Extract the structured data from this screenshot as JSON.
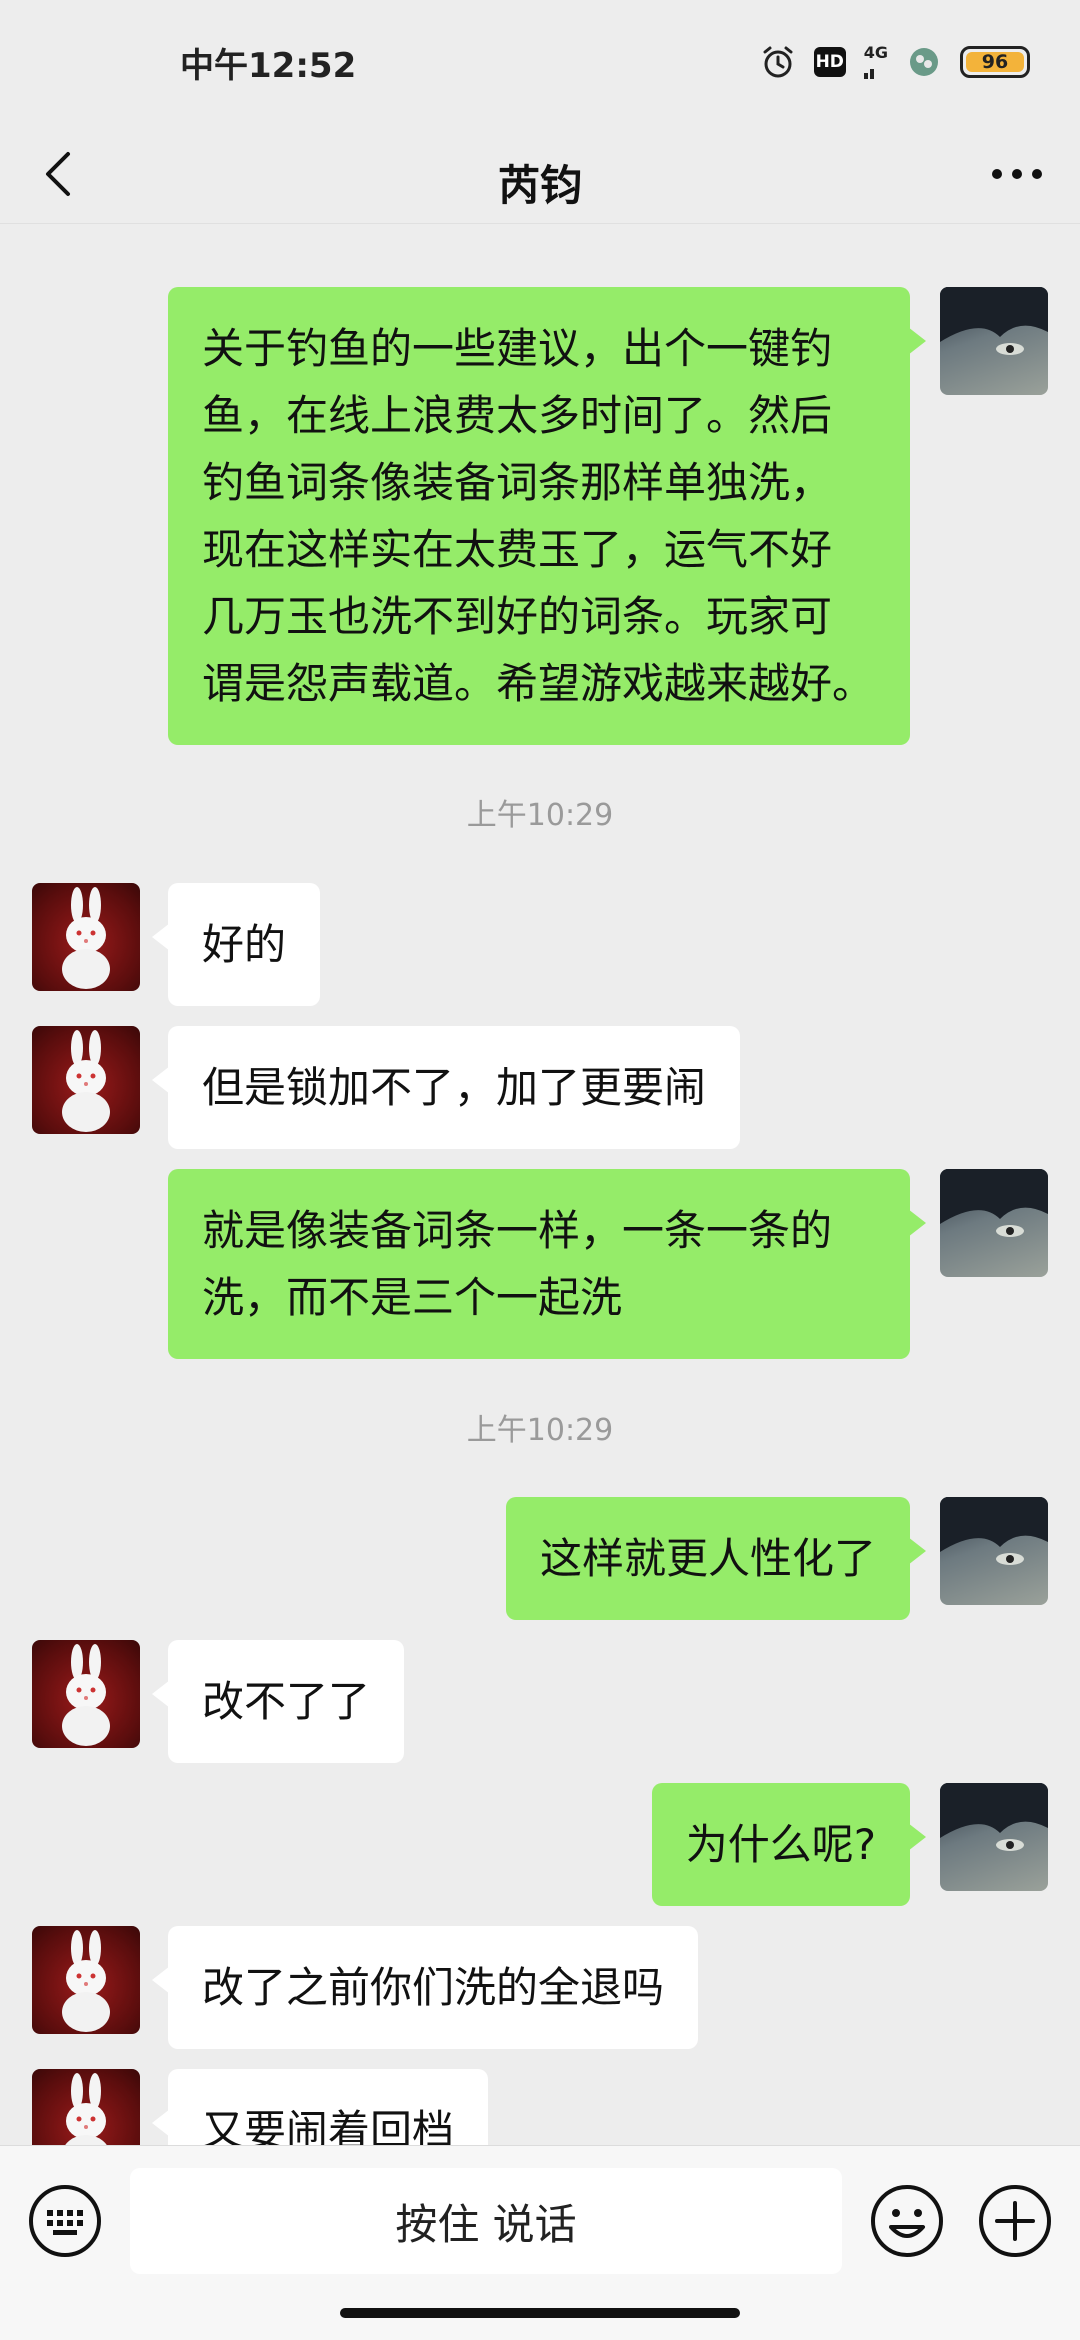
{
  "status_bar": {
    "time": "中午12:52",
    "hd": "HD",
    "network": "4G",
    "battery": "96"
  },
  "header": {
    "title": "芮钧",
    "back_icon": "chevron-left-icon",
    "more_icon": "more-horizontal-icon"
  },
  "messages": [
    {
      "sender": "me",
      "lines": [
        "关于钓鱼的一些建议，出个一键钓",
        "鱼，在线上浪费太多时间了。然后",
        "钓鱼词条像装备词条那样单独洗，",
        "现在这样实在太费玉了，运气不好",
        "几万玉也洗不到好的词条。玩家可",
        "谓是怨声载道。希望游戏越来越好。"
      ]
    },
    {
      "timestamp": "上午10:29"
    },
    {
      "sender": "other",
      "text": "好的"
    },
    {
      "sender": "other",
      "text": "但是锁加不了，加了更要闹"
    },
    {
      "sender": "me",
      "lines": [
        "就是像装备词条一样，一条一条的",
        "洗，而不是三个一起洗"
      ]
    },
    {
      "timestamp": "上午10:29"
    },
    {
      "sender": "me",
      "text": "这样就更人性化了"
    },
    {
      "sender": "other",
      "text": "改不了了"
    },
    {
      "sender": "me",
      "text": "为什么呢?"
    },
    {
      "sender": "other",
      "text": "改了之前你们洗的全退吗"
    },
    {
      "sender": "other",
      "text": "又要闹着回档"
    }
  ],
  "input_bar": {
    "voice_label": "按住 说话",
    "keyboard_icon": "keyboard-icon",
    "emoji_icon": "emoji-icon",
    "plus_icon": "plus-icon"
  },
  "colors": {
    "my_bubble": "#95ec69",
    "other_bubble": "#ffffff",
    "background": "#ededed"
  }
}
